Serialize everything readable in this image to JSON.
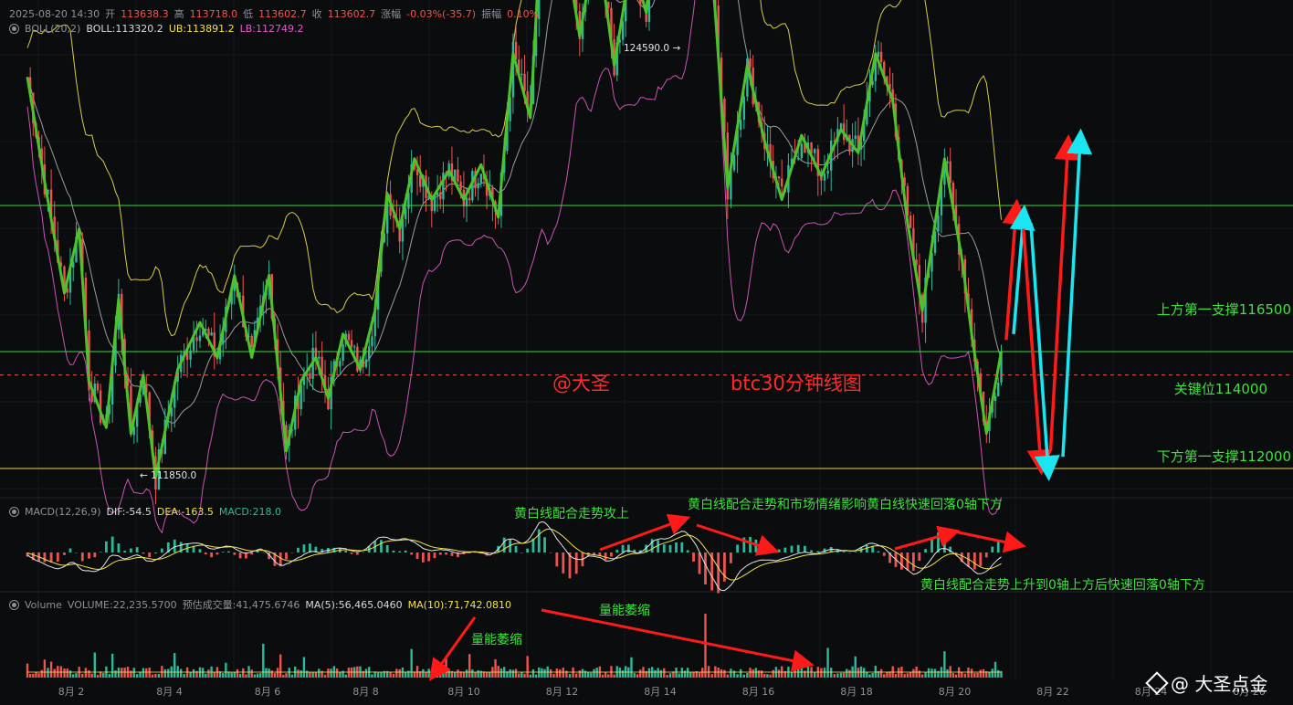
{
  "header": {
    "time": "2025-08-20 14:30",
    "open_label": "开",
    "open": "113638.3",
    "high_label": "高",
    "high": "113718.0",
    "low_label": "低",
    "low": "113602.7",
    "close_label": "收",
    "close": "113602.7",
    "change_label": "涨幅",
    "change": "-0.03%(-35.7)",
    "amp_label": "振幅",
    "amp": "0.10%"
  },
  "boll": {
    "name": "BOLL(20,2)",
    "mid": "BOLL:113320.2",
    "ub": "UB:113891.2",
    "lb": "LB:112749.2"
  },
  "macd": {
    "name": "MACD(12,26,9)",
    "dif": "DIF:-54.5",
    "dea": "DEA:-163.5",
    "macd": "MACD:218.0"
  },
  "volume": {
    "name": "Volume",
    "vol": "VOLUME:22,235.5700",
    "est": "预估成交量:41,475.6746",
    "ma5": "MA(5):56,465.0460",
    "ma10": "MA(10):71,742.0810"
  },
  "labels": {
    "high_mark": "124590.0",
    "low_mark": "111850.0",
    "upper_support": "上方第一支撑116500",
    "key_level": "关键位114000",
    "lower_support": "下方第一支撑112000",
    "author": "@大圣",
    "chart_title": "btc30分钟线图",
    "macd_note1": "黄白线配合走势攻上",
    "macd_note2": "黄白线配合走势和市场情绪影响黄白线快速回落0轴下方",
    "macd_note3": "黄白线配合走势上升到0轴上方后快速回落0轴下方",
    "vol_note1": "量能萎缩",
    "vol_note2": "量能萎缩",
    "watermark": "@ 大圣点金"
  },
  "colors": {
    "up": "#2eb89a",
    "down": "#ef5350",
    "boll_upper": "#f2e14b",
    "boll_lower": "#e05cc8",
    "boll_mid": "#d7dade",
    "wave": "#4cc32a",
    "level": "#3fe03f",
    "arrow_red": "#ff1a1a",
    "arrow_cyan": "#19e6f0"
  },
  "chart_data": {
    "type": "line",
    "title": "btc30分钟线图",
    "x_ticks": [
      "8月 2",
      "8月 4",
      "8月 6",
      "8月 8",
      "8月 10",
      "8月 12",
      "8月 14",
      "8月 16",
      "8月 18",
      "8月 20",
      "8月 22",
      "8月 24",
      "8月 26"
    ],
    "levels": [
      116500,
      114000,
      112000
    ],
    "marked_high": 124590.0,
    "marked_low": 111850.0,
    "wave_path": [
      [
        1.0,
        118700
      ],
      [
        1.35,
        116900
      ],
      [
        1.75,
        115000
      ],
      [
        2.05,
        116100
      ],
      [
        2.25,
        113500
      ],
      [
        2.6,
        112700
      ],
      [
        2.85,
        114900
      ],
      [
        3.1,
        112600
      ],
      [
        3.35,
        113600
      ],
      [
        3.6,
        111850
      ],
      [
        4.05,
        113700
      ],
      [
        4.5,
        114500
      ],
      [
        4.85,
        113900
      ],
      [
        5.2,
        115300
      ],
      [
        5.55,
        113900
      ],
      [
        5.9,
        115300
      ],
      [
        6.25,
        112300
      ],
      [
        6.55,
        113500
      ],
      [
        6.85,
        113900
      ],
      [
        7.1,
        113200
      ],
      [
        7.4,
        114300
      ],
      [
        7.75,
        113700
      ],
      [
        8.05,
        114700
      ],
      [
        8.3,
        116700
      ],
      [
        8.55,
        116100
      ],
      [
        8.85,
        117300
      ],
      [
        9.2,
        116600
      ],
      [
        9.55,
        117100
      ],
      [
        9.85,
        116600
      ],
      [
        10.2,
        117200
      ],
      [
        10.55,
        116300
      ],
      [
        10.85,
        119100
      ],
      [
        11.2,
        118000
      ],
      [
        11.55,
        123200
      ],
      [
        11.8,
        121500
      ],
      [
        12.2,
        119400
      ],
      [
        12.55,
        121100
      ],
      [
        12.9,
        118900
      ],
      [
        13.25,
        120700
      ],
      [
        13.55,
        119800
      ],
      [
        13.85,
        121900
      ],
      [
        14.1,
        122200
      ],
      [
        14.45,
        124590
      ],
      [
        14.75,
        122400
      ],
      [
        14.95,
        119800
      ],
      [
        15.2,
        116800
      ],
      [
        15.6,
        118900
      ],
      [
        15.95,
        117600
      ],
      [
        16.3,
        116600
      ],
      [
        16.7,
        117700
      ],
      [
        17.1,
        117000
      ],
      [
        17.5,
        117800
      ],
      [
        17.85,
        117400
      ],
      [
        18.2,
        119100
      ],
      [
        18.55,
        118300
      ],
      [
        18.85,
        116200
      ],
      [
        19.15,
        114700
      ],
      [
        19.6,
        117300
      ],
      [
        19.95,
        115600
      ],
      [
        20.15,
        114300
      ],
      [
        20.45,
        112600
      ],
      [
        20.75,
        114000
      ]
    ],
    "forecast_arrows": [
      {
        "color": "red",
        "from": [
          20.85,
          114200
        ],
        "to": [
          21.05,
          116400
        ]
      },
      {
        "color": "cyan",
        "from": [
          21.0,
          114300
        ],
        "to": [
          21.2,
          116300
        ]
      },
      {
        "color": "red",
        "from": [
          21.2,
          116100
        ],
        "to": [
          21.55,
          112100
        ]
      },
      {
        "color": "cyan",
        "from": [
          21.35,
          116200
        ],
        "to": [
          21.7,
          112000
        ]
      },
      {
        "color": "red",
        "from": [
          21.75,
          112300
        ],
        "to": [
          22.1,
          117500
        ]
      },
      {
        "color": "cyan",
        "from": [
          22.0,
          112200
        ],
        "to": [
          22.35,
          117600
        ]
      }
    ]
  }
}
